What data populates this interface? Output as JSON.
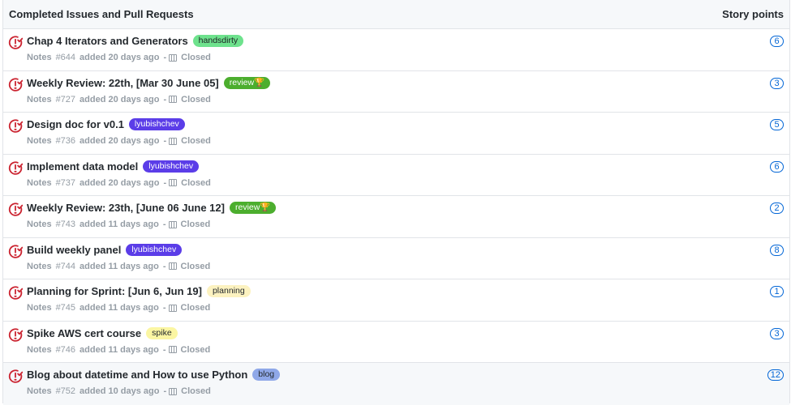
{
  "header": {
    "title": "Completed Issues and Pull Requests",
    "points_label": "Story points"
  },
  "issues": [
    {
      "title": "Chap 4 Iterators and Generators",
      "label": "handsdirty",
      "label_bg": "#6ee28d",
      "label_fg": "#1b1f23",
      "repo": "Notes",
      "number": "#644",
      "added": "added 20 days ago",
      "status": "Closed",
      "points": "6"
    },
    {
      "title": "Weekly Review: 22th, [Mar 30 June 05]",
      "label": "review🏆",
      "label_bg": "#4cae2e",
      "label_fg": "#ffffff",
      "repo": "Notes",
      "number": "#727",
      "added": "added 20 days ago",
      "status": "Closed",
      "points": "3"
    },
    {
      "title": "Design doc for v0.1",
      "label": "lyubishchev",
      "label_bg": "#5b3de8",
      "label_fg": "#ffffff",
      "repo": "Notes",
      "number": "#736",
      "added": "added 20 days ago",
      "status": "Closed",
      "points": "5"
    },
    {
      "title": "Implement data model",
      "label": "lyubishchev",
      "label_bg": "#5b3de8",
      "label_fg": "#ffffff",
      "repo": "Notes",
      "number": "#737",
      "added": "added 20 days ago",
      "status": "Closed",
      "points": "6"
    },
    {
      "title": "Weekly Review: 23th, [June 06 June 12]",
      "label": "review🏆",
      "label_bg": "#4cae2e",
      "label_fg": "#ffffff",
      "repo": "Notes",
      "number": "#743",
      "added": "added 11 days ago",
      "status": "Closed",
      "points": "2"
    },
    {
      "title": "Build weekly panel",
      "label": "lyubishchev",
      "label_bg": "#5b3de8",
      "label_fg": "#ffffff",
      "repo": "Notes",
      "number": "#744",
      "added": "added 11 days ago",
      "status": "Closed",
      "points": "8"
    },
    {
      "title": "Planning for Sprint: [Jun 6, Jun 19]",
      "label": "planning",
      "label_bg": "#fcf2c0",
      "label_fg": "#24292e",
      "repo": "Notes",
      "number": "#745",
      "added": "added 11 days ago",
      "status": "Closed",
      "points": "1"
    },
    {
      "title": "Spike AWS cert course",
      "label": "spike",
      "label_bg": "#fbf6a3",
      "label_fg": "#24292e",
      "repo": "Notes",
      "number": "#746",
      "added": "added 11 days ago",
      "status": "Closed",
      "points": "3"
    },
    {
      "title": "Blog about datetime and How to use Python",
      "label": "blog",
      "label_bg": "#8fa8e8",
      "label_fg": "#24292e",
      "repo": "Notes",
      "number": "#752",
      "added": "added 10 days ago",
      "status": "Closed",
      "points": "12"
    }
  ],
  "colors": {
    "closed_icon": "#cb2431",
    "points_border": "#0366d6"
  },
  "icons": {
    "status": "issue-closed-icon",
    "board": "project-board-icon"
  }
}
